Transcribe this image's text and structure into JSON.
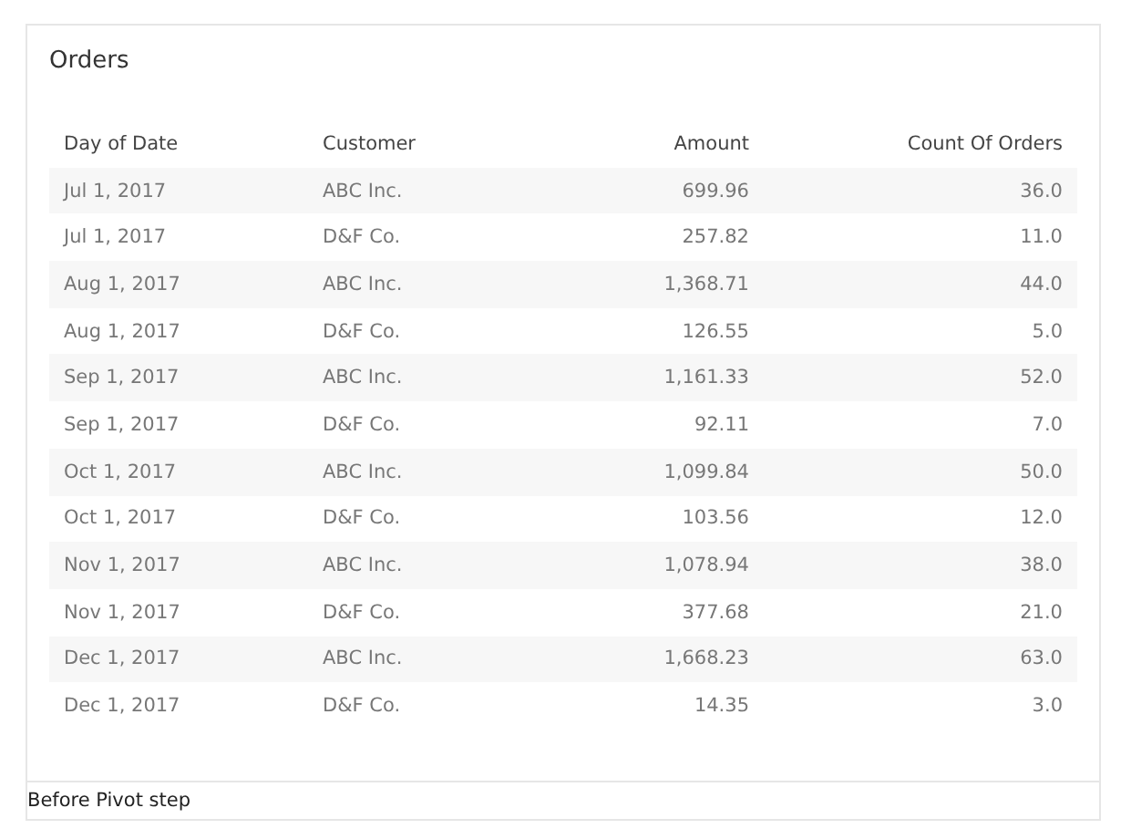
{
  "card": {
    "title": "Orders"
  },
  "table": {
    "columns": [
      "Day of Date",
      "Customer",
      "Amount",
      "Count Of Orders"
    ],
    "rows": [
      [
        "Jul 1, 2017",
        "ABC Inc.",
        "699.96",
        "36.0"
      ],
      [
        "Jul 1, 2017",
        "D&F Co.",
        "257.82",
        "11.0"
      ],
      [
        "Aug 1, 2017",
        "ABC Inc.",
        "1,368.71",
        "44.0"
      ],
      [
        "Aug 1, 2017",
        "D&F Co.",
        "126.55",
        "5.0"
      ],
      [
        "Sep 1, 2017",
        "ABC Inc.",
        "1,161.33",
        "52.0"
      ],
      [
        "Sep 1, 2017",
        "D&F Co.",
        "92.11",
        "7.0"
      ],
      [
        "Oct 1, 2017",
        "ABC Inc.",
        "1,099.84",
        "50.0"
      ],
      [
        "Oct 1, 2017",
        "D&F Co.",
        "103.56",
        "12.0"
      ],
      [
        "Nov 1, 2017",
        "ABC Inc.",
        "1,078.94",
        "38.0"
      ],
      [
        "Nov 1, 2017",
        "D&F Co.",
        "377.68",
        "21.0"
      ],
      [
        "Dec 1, 2017",
        "ABC Inc.",
        "1,668.23",
        "63.0"
      ],
      [
        "Dec 1, 2017",
        "D&F Co.",
        "14.35",
        "3.0"
      ]
    ]
  },
  "caption": "Before Pivot step"
}
